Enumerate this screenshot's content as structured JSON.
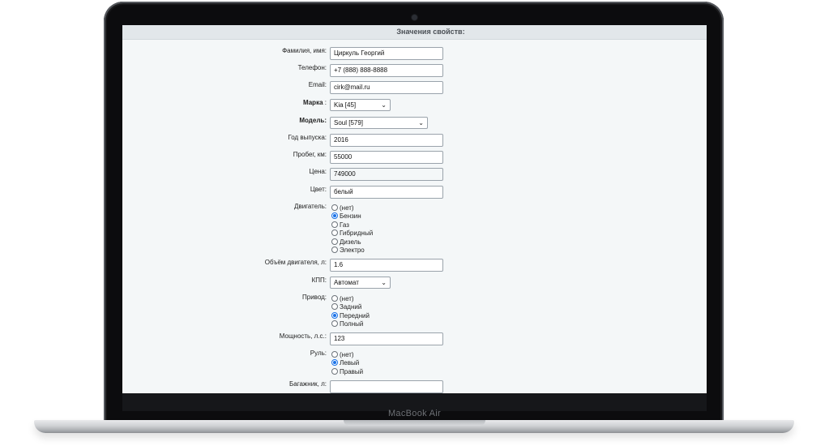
{
  "device": {
    "model_label": "MacBook Air"
  },
  "form": {
    "header": "Значения свойств:",
    "fields": {
      "name": {
        "label": "Фамилия, имя:",
        "value": "Циркуль Георгий"
      },
      "phone": {
        "label": "Телефон:",
        "value": "+7 (888) 888-8888"
      },
      "email": {
        "label": "Email:",
        "value": "cirk@mail.ru"
      },
      "brand": {
        "label": "Марка",
        "colon": ":",
        "value": "Kia [45]"
      },
      "model": {
        "label": "Модель:",
        "value": "Soul [579]"
      },
      "year": {
        "label": "Год выпуска:",
        "value": "2016"
      },
      "mileage": {
        "label": "Пробег, км:",
        "value": "55000"
      },
      "price": {
        "label": "Цена:",
        "value": "749000"
      },
      "color": {
        "label": "Цвет:",
        "value": "белый"
      },
      "engine": {
        "label": "Двигатель:",
        "options": [
          "(нет)",
          "Бензин",
          "Газ",
          "Гибридный",
          "Дизель",
          "Электро"
        ],
        "selected": "Бензин"
      },
      "volume": {
        "label": "Объём двигателя, л:",
        "value": "1.6"
      },
      "gearbox": {
        "label": "КПП:",
        "value": "Автомат"
      },
      "drive": {
        "label": "Привод:",
        "options": [
          "(нет)",
          "Задний",
          "Передний",
          "Полный"
        ],
        "selected": "Передний"
      },
      "power": {
        "label": "Мощность, л.с.:",
        "value": "123"
      },
      "steering": {
        "label": "Руль:",
        "options": [
          "(нет)",
          "Левый",
          "Правый"
        ],
        "selected": "Левый"
      },
      "trunk": {
        "label": "Багажник, л:",
        "value": ""
      }
    }
  }
}
